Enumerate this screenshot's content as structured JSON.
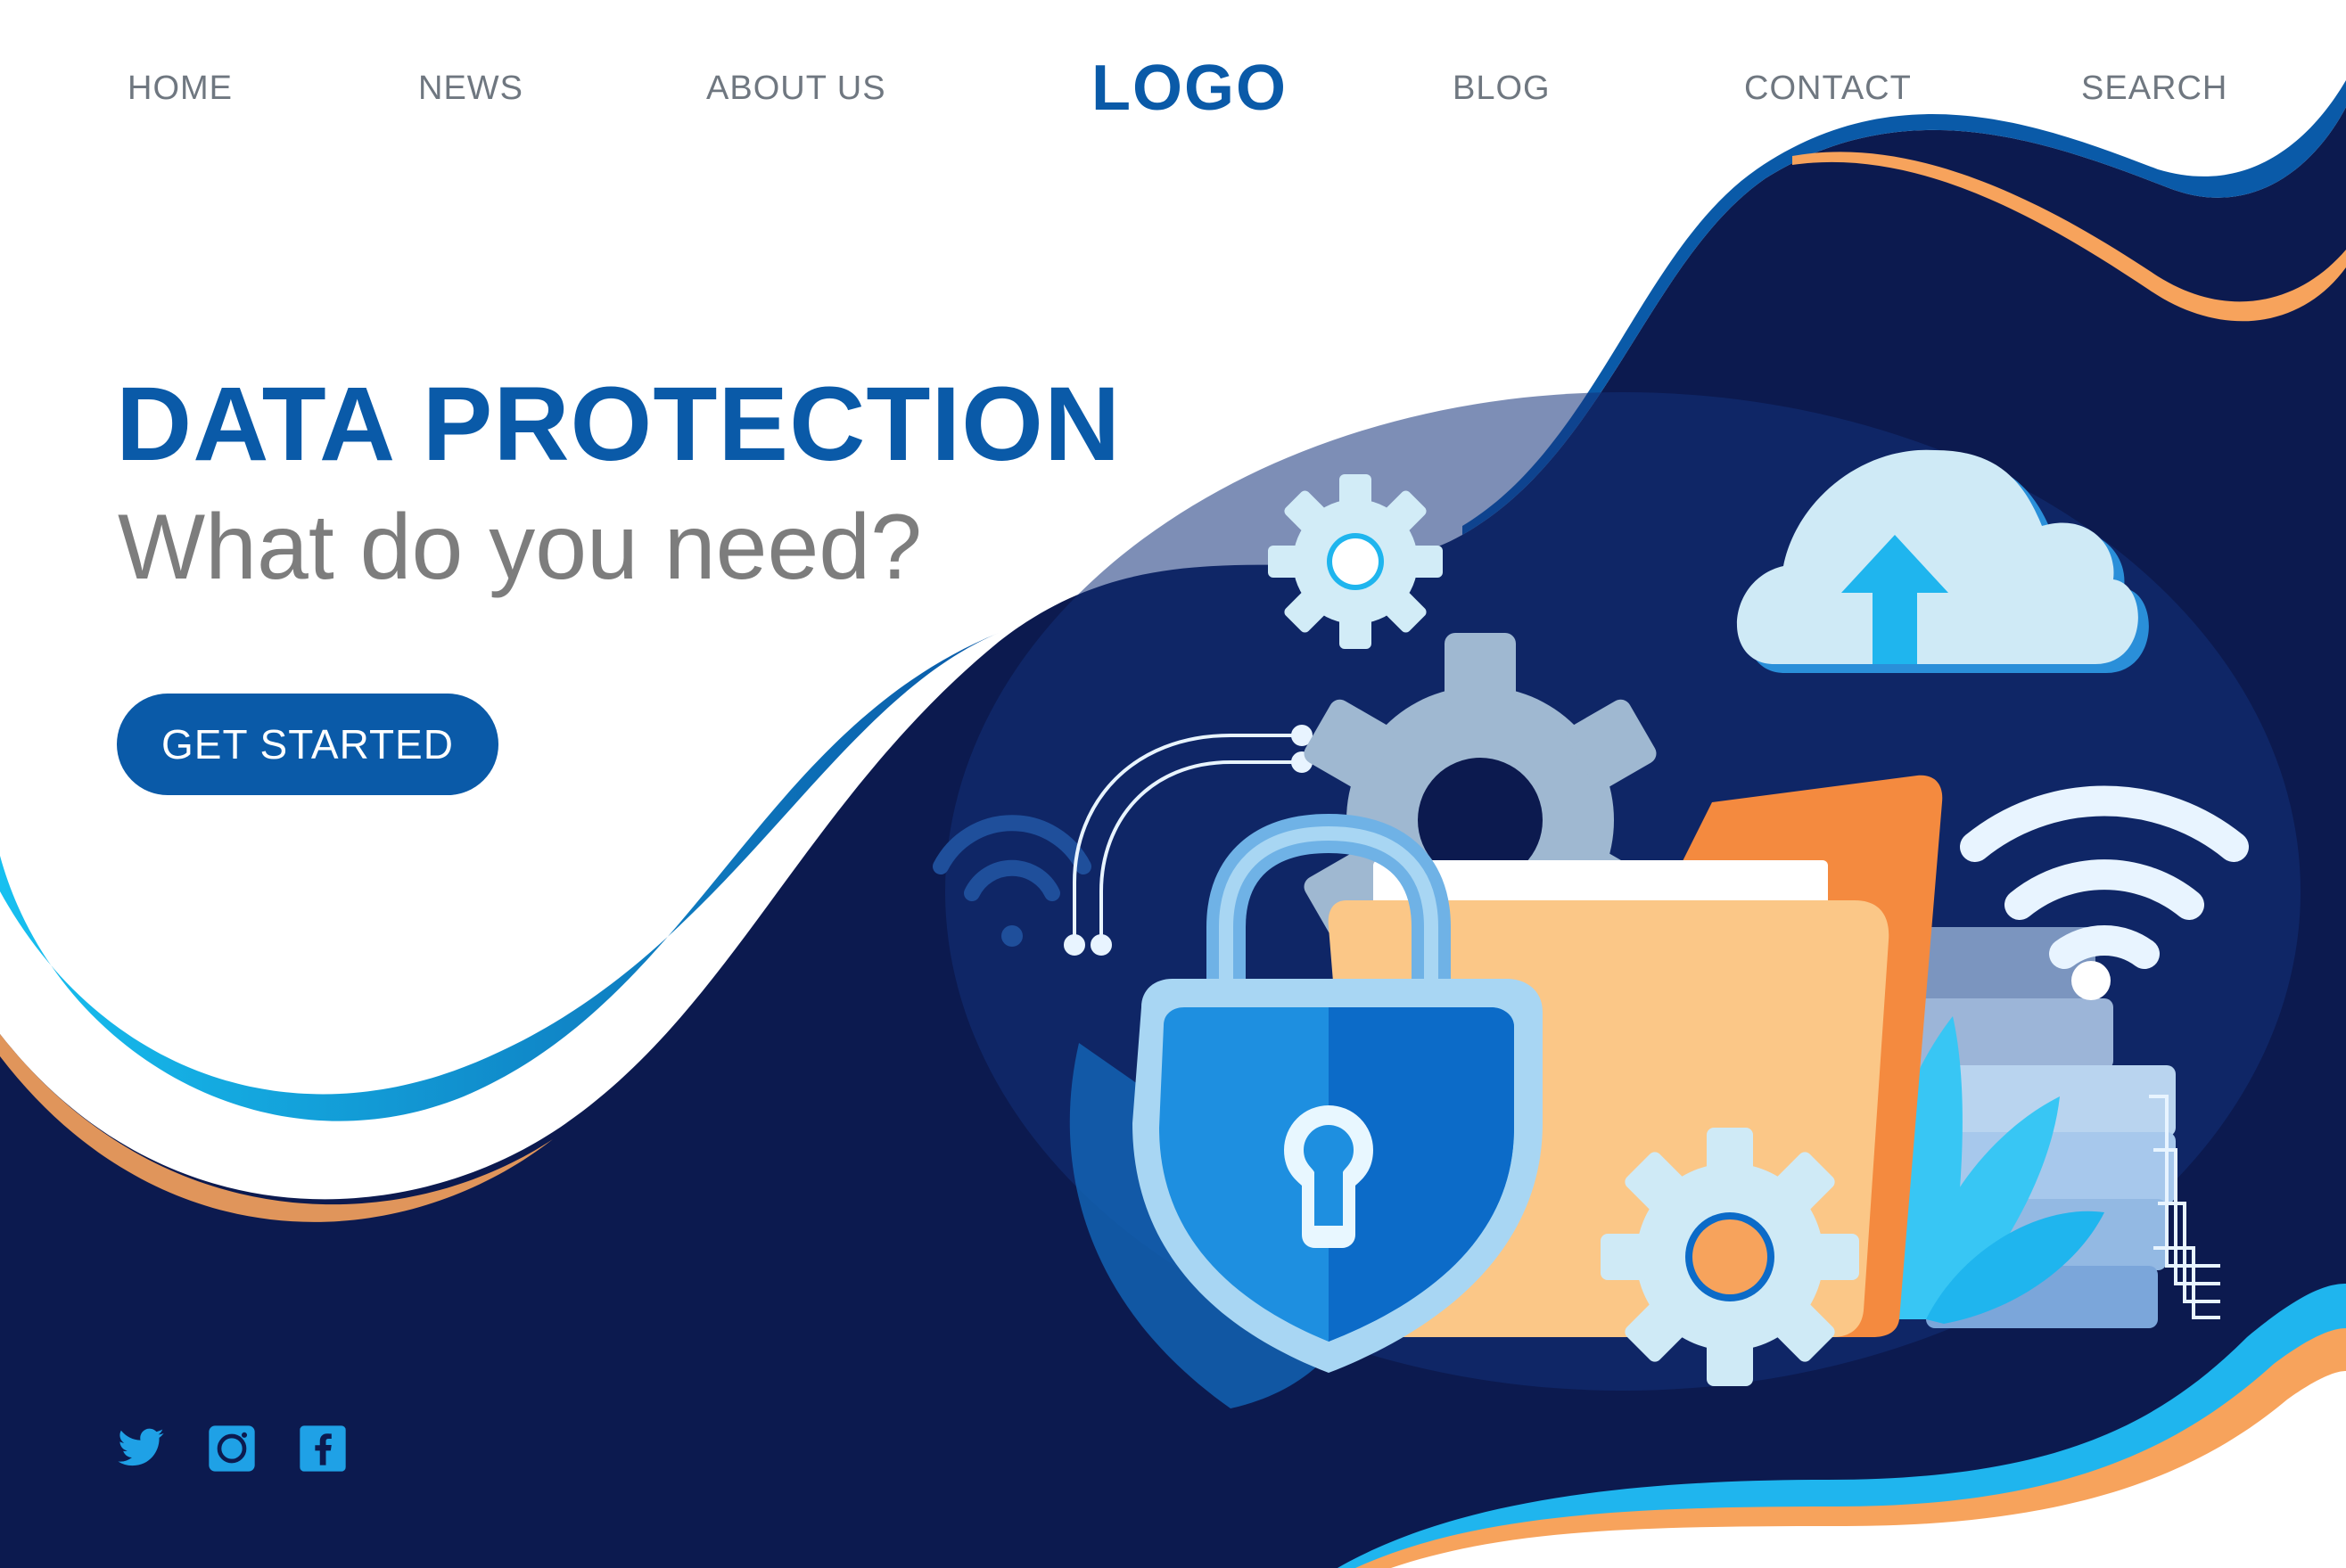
{
  "nav": {
    "home": "HOME",
    "news": "NEWS",
    "about": "ABOUT US",
    "logo": "LOGO",
    "blog": "BLOG",
    "contact": "CONTACT",
    "search": "SEARCH"
  },
  "hero": {
    "title": "DATA PROTECTION",
    "subtitle": "What do you need?",
    "cta_label": "GET STARTED"
  },
  "social": [
    "twitter-icon",
    "instagram-icon",
    "facebook-icon"
  ],
  "colors": {
    "brand_blue": "#0a5aa8",
    "navy": "#0c1a4f",
    "cyan": "#1fb5ee",
    "orange": "#f7a35c",
    "nav_text": "#6f7780",
    "subtitle_text": "#7d7d7d"
  }
}
